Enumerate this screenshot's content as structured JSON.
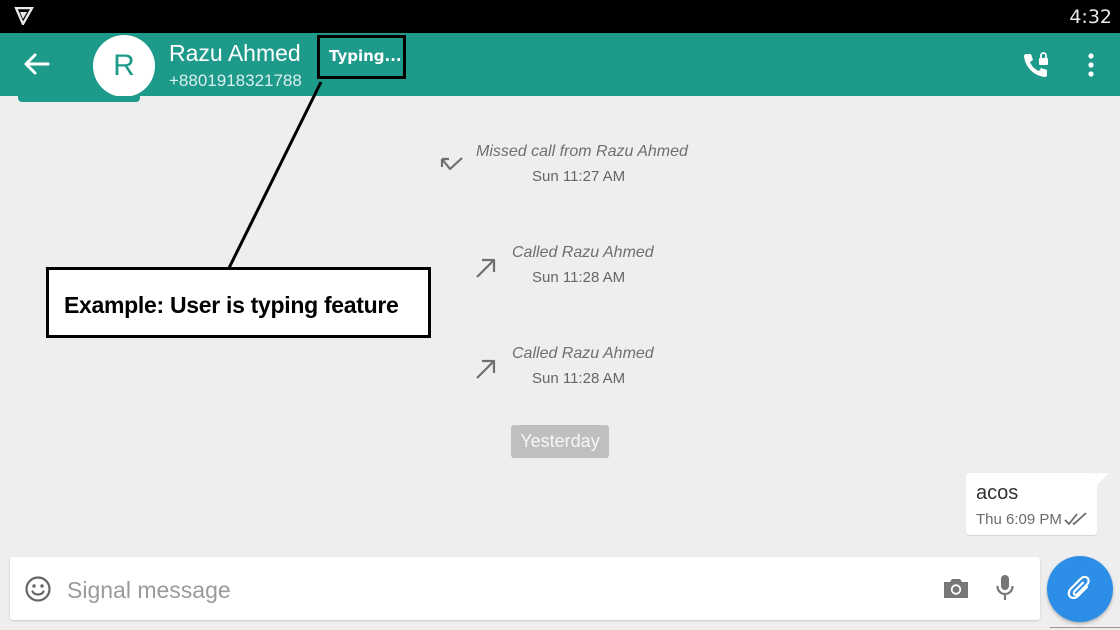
{
  "status_bar": {
    "time": "4:32"
  },
  "conversation": {
    "contact_name": "Razu Ahmed",
    "contact_phone": "+8801918321788",
    "avatar_initial": "R",
    "typing_indicator": "Typing..."
  },
  "call_log": [
    {
      "title": "Missed call from Razu Ahmed",
      "time": "Sun 11:27 AM",
      "icon": "missed-call-arrow"
    },
    {
      "title": "Called Razu Ahmed",
      "time": "Sun 11:28 AM",
      "icon": "outgoing-call-arrow"
    },
    {
      "title": "Called Razu Ahmed",
      "time": "Sun 11:28 AM",
      "icon": "outgoing-call-arrow"
    }
  ],
  "date_separator": "Yesterday",
  "outgoing_message": {
    "text": "acos",
    "time": "Thu 6:09 PM",
    "status_icon": "double-check"
  },
  "annotation": {
    "label": "Example: User is typing feature"
  },
  "composer": {
    "placeholder": "Signal message"
  },
  "colors": {
    "toolbar": "#1e9a8b",
    "attach_button": "#2c8ee6",
    "background": "#eeeeee"
  }
}
